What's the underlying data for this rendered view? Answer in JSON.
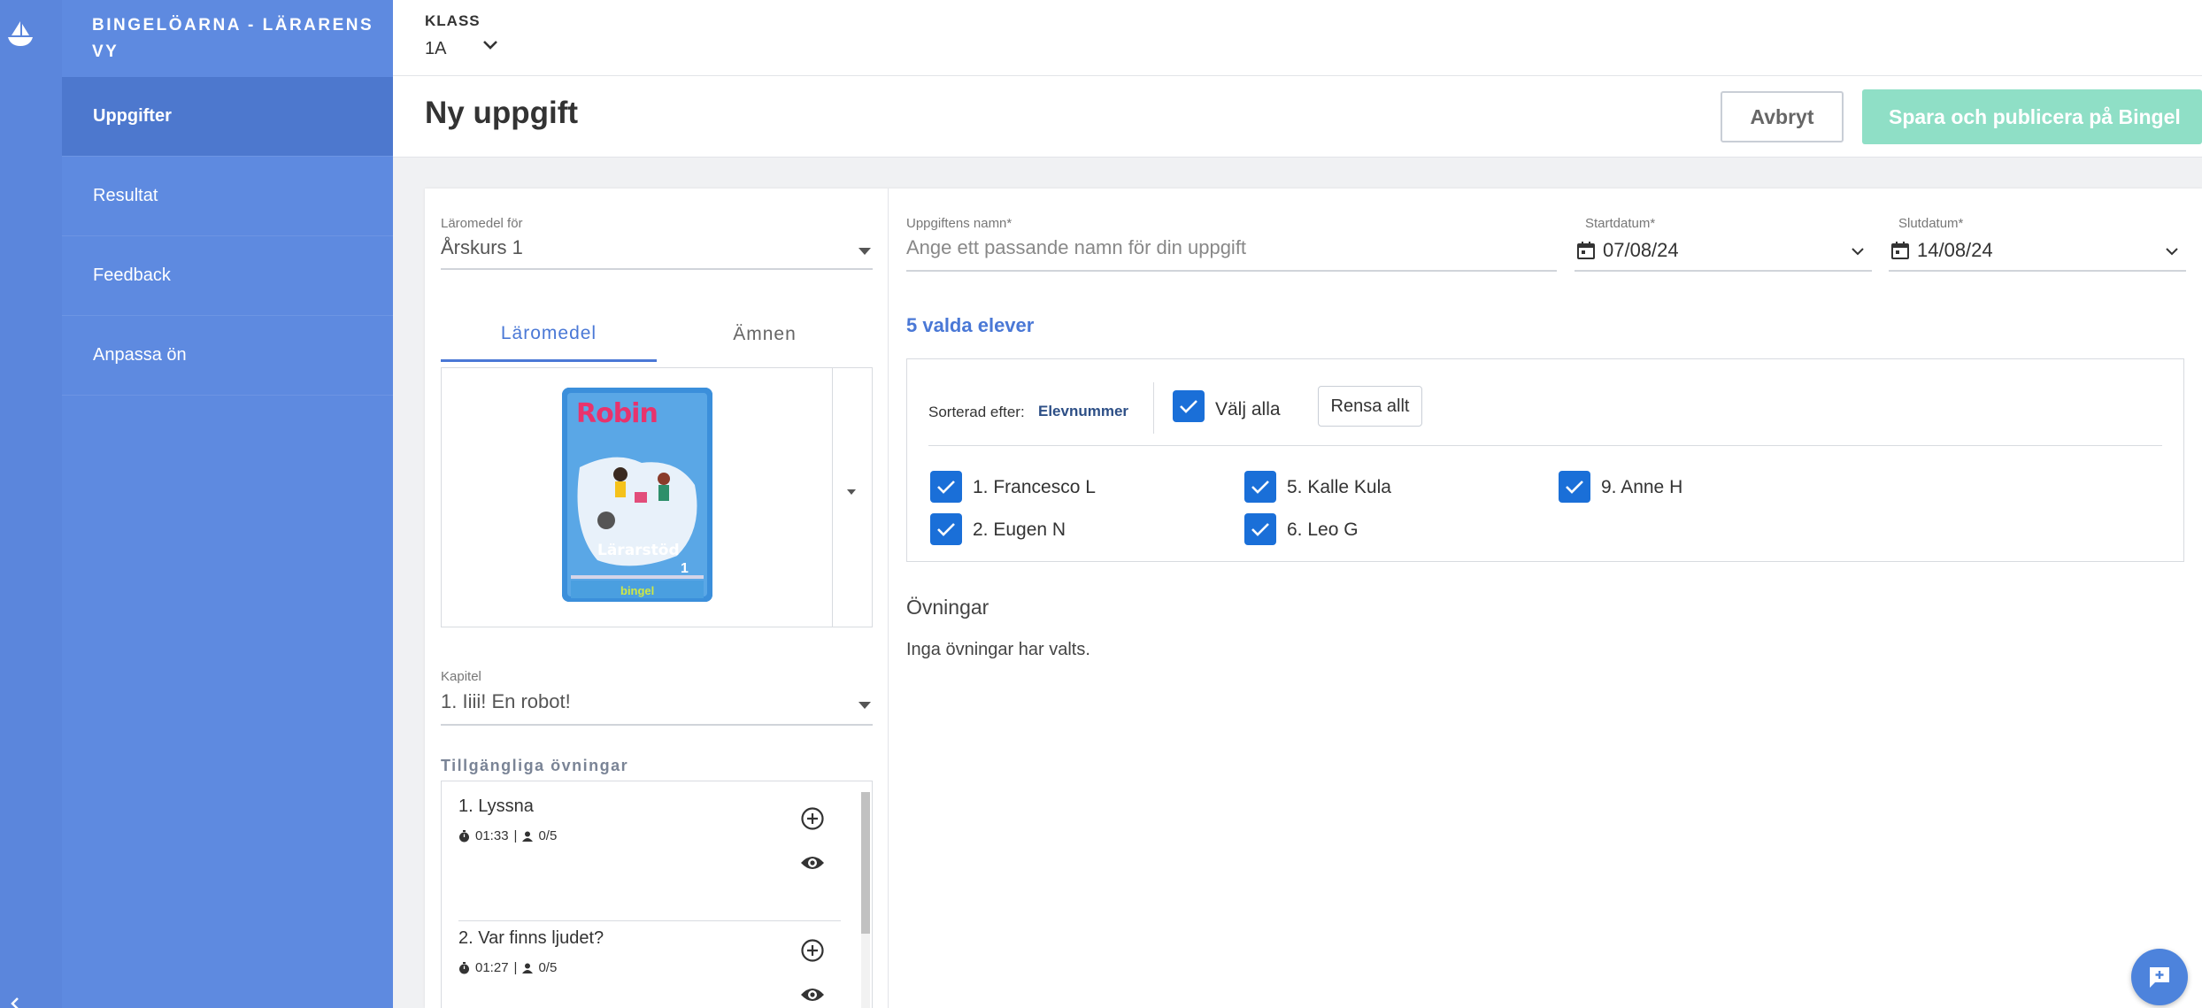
{
  "app": {
    "brand": "BINGELÖARNA - LÄRARENS VY"
  },
  "sidebar": {
    "items": [
      {
        "label": "Uppgifter",
        "active": true
      },
      {
        "label": "Resultat",
        "active": false
      },
      {
        "label": "Feedback",
        "active": false
      },
      {
        "label": "Anpassa ön",
        "active": false
      }
    ]
  },
  "header": {
    "klass_label": "KLASS",
    "klass_value": "1A"
  },
  "titlebar": {
    "title": "Ny uppgift",
    "cancel_label": "Avbryt",
    "publish_label": "Spara och publicera på Bingel"
  },
  "left_panel": {
    "laromedel_label": "Läromedel för",
    "laromedel_value": "Årskurs 1",
    "tabs": [
      "Läromedel",
      "Ämnen"
    ],
    "book": {
      "title": "Robin",
      "subtitle": "Lärarstöd",
      "grade": "1",
      "publisher": "bingel"
    },
    "kapitel_label": "Kapitel",
    "kapitel_value": "1. Iiii! En robot!",
    "available_title": "Tillgängliga övningar",
    "exercises": [
      {
        "name": "1. Lyssna",
        "time": "01:33",
        "students": "0/5"
      },
      {
        "name": "2. Var finns ljudet?",
        "time": "01:27",
        "students": "0/5"
      }
    ],
    "separator": "|"
  },
  "right_panel": {
    "name_label": "Uppgiftens namn*",
    "name_placeholder": "Ange ett passande namn för din uppgift",
    "start_label": "Startdatum*",
    "start_value": "07/08/24",
    "end_label": "Slutdatum*",
    "end_value": "14/08/24",
    "selected_count": "5 valda elever",
    "sort_label": "Sorterad efter:",
    "sort_value": "Elevnummer",
    "select_all_label": "Välj alla",
    "clear_all_label": "Rensa allt",
    "students": [
      {
        "label": "1. Francesco L",
        "checked": true
      },
      {
        "label": "2. Eugen N",
        "checked": true
      },
      {
        "label": "5. Kalle Kula",
        "checked": true
      },
      {
        "label": "6. Leo G",
        "checked": true
      },
      {
        "label": "9. Anne H",
        "checked": true
      }
    ],
    "exercises_title": "Övningar",
    "exercises_empty": "Inga övningar har valts."
  },
  "colors": {
    "sidebar": "#5e8ae0",
    "sidebar_active": "#4d78ce",
    "accent": "#4a78d6",
    "checkbox": "#1a6fd8",
    "publish_disabled": "#8fdfc6"
  },
  "icons": {
    "logo": "island-boat-icon",
    "collapse": "chevron-left-icon",
    "klass": "chevron-down-icon",
    "add": "plus-circle-icon",
    "view": "eye-icon",
    "time": "stopwatch-icon",
    "students": "person-icon",
    "calendar": "calendar-icon",
    "chat": "chat-plus-icon"
  }
}
